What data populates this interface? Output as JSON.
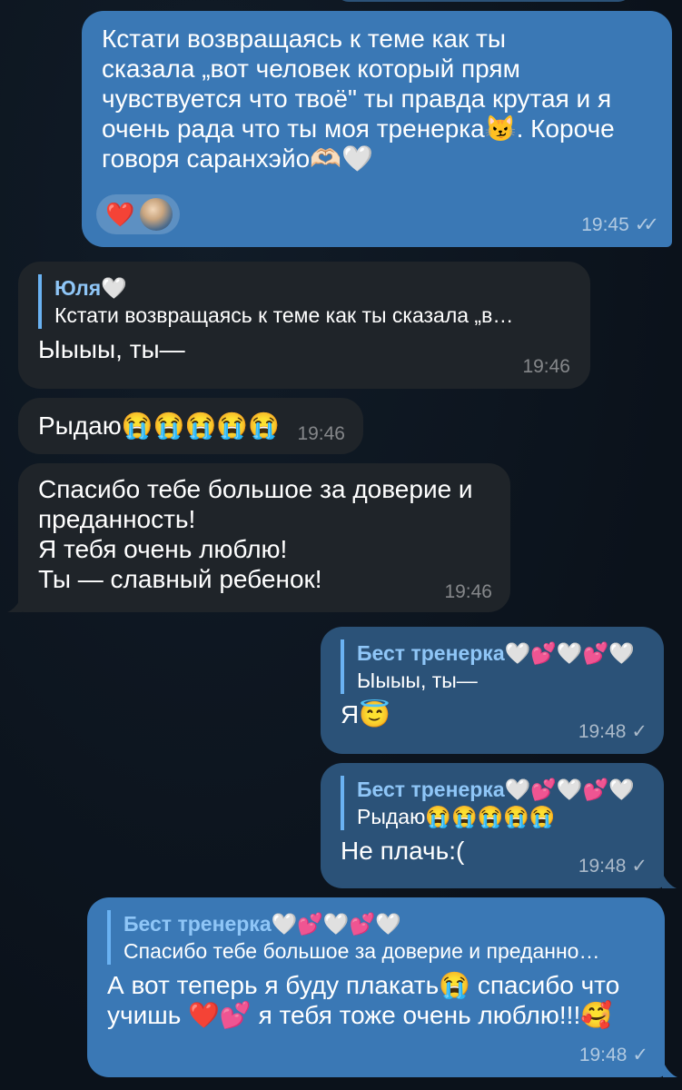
{
  "messages": [
    {
      "id": "m1",
      "text": "Кстати возвращаясь к теме как ты\nсказала „вот человек который прям\nчувствуется что твоё\" ты правда крутая и я\nочень рада что ты моя тренерка😼. Короче\nговоря саранхэйо🫶🏻🤍",
      "reaction_emoji": "❤️",
      "time": "19:45",
      "status": "✓✓"
    },
    {
      "id": "m2",
      "reply_name": "Юля🤍",
      "reply_text": "Кстати возвращаясь к теме как ты сказала „в…",
      "text": "Ыыыы, ты—",
      "time": "19:46"
    },
    {
      "id": "m3",
      "text": "Рыдаю😭😭😭😭😭",
      "time": "19:46"
    },
    {
      "id": "m4",
      "text": "Спасибо тебе большое за доверие и\nпреданность!\nЯ тебя очень люблю!\nТы — славный ребенок!",
      "time": "19:46"
    },
    {
      "id": "m5",
      "reply_name": "Бест тренерка🤍💕🤍💕🤍",
      "reply_text": "Ыыыы, ты—",
      "text": "Я😇",
      "time": "19:48",
      "status": "✓"
    },
    {
      "id": "m6",
      "reply_name": "Бест тренерка🤍💕🤍💕🤍",
      "reply_text": "Рыдаю😭😭😭😭😭",
      "text": "Не плачь:(",
      "time": "19:48",
      "status": "✓"
    },
    {
      "id": "m7",
      "reply_name": "Бест тренерка🤍💕🤍💕🤍",
      "reply_text": "Спасибо тебе большое за доверие и преданно…",
      "text": "А вот теперь я буду плакать😭 спасибо что\nучишь ❤️💕 я тебя тоже очень люблю!!!🥰",
      "time": "19:48",
      "status": "✓"
    }
  ],
  "colors": {
    "background": "#0e1621",
    "outgoing_bubble": "#2b5278",
    "outgoing_bubble_highlight": "#3a78b5",
    "incoming_bubble": "#1f2429",
    "reply_accent": "#6ab2f2"
  }
}
